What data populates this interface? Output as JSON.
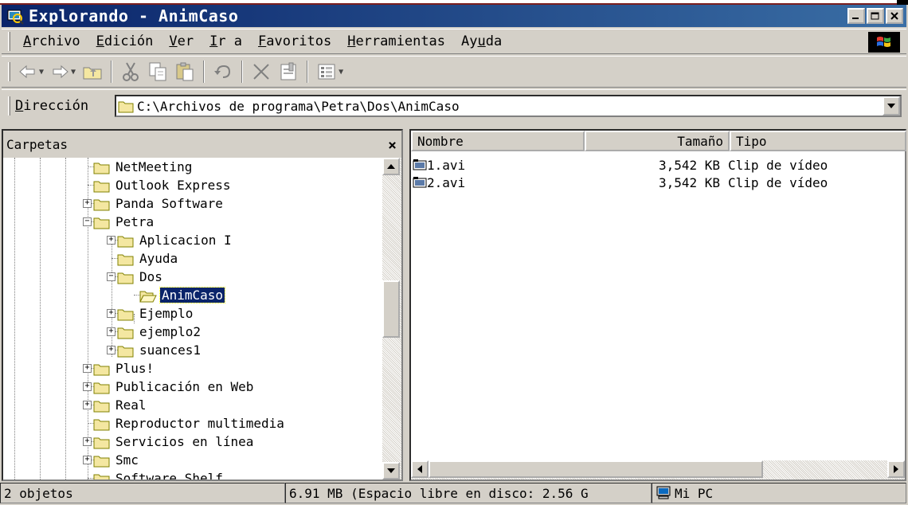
{
  "window": {
    "title": "Explorando - AnimCaso"
  },
  "menu": {
    "items": [
      {
        "u": "A",
        "rest": "rchivo"
      },
      {
        "u": "E",
        "rest": "dición"
      },
      {
        "u": "V",
        "rest": "er"
      },
      {
        "u": "I",
        "rest": "r a"
      },
      {
        "u": "F",
        "rest": "avoritos"
      },
      {
        "u": "H",
        "rest": "erramientas"
      },
      {
        "pre": "Ay",
        "u": "u",
        "rest": "da"
      }
    ]
  },
  "toolbar": {
    "buttons": [
      "back-icon",
      "forward-icon",
      "up-folder-icon",
      "cut-icon",
      "copy-icon",
      "paste-icon",
      "undo-icon",
      "delete-icon",
      "properties-icon",
      "views-icon"
    ]
  },
  "address": {
    "label_u": "D",
    "label_rest": "irección",
    "path": "C:\\Archivos de programa\\Petra\\Dos\\AnimCaso"
  },
  "folders": {
    "header": "Carpetas",
    "close": "×",
    "tree": [
      {
        "label": "NetMeeting",
        "expander": "none",
        "level": 0
      },
      {
        "label": "Outlook Express",
        "expander": "none",
        "level": 0
      },
      {
        "label": "Panda Software",
        "expander": "+",
        "level": 0
      },
      {
        "label": "Petra",
        "expander": "-",
        "level": 0
      },
      {
        "label": "Aplicacion I",
        "expander": "+",
        "level": 1
      },
      {
        "label": "Ayuda",
        "expander": "none",
        "level": 1
      },
      {
        "label": "Dos",
        "expander": "-",
        "level": 1
      },
      {
        "label": "AnimCaso",
        "expander": "none",
        "level": 2,
        "selected": true
      },
      {
        "label": "Ejemplo",
        "expander": "+",
        "level": 1
      },
      {
        "label": "ejemplo2",
        "expander": "+",
        "level": 1
      },
      {
        "label": "suances1",
        "expander": "+",
        "level": 1
      },
      {
        "label": "Plus!",
        "expander": "+",
        "level": 0
      },
      {
        "label": "Publicación en Web",
        "expander": "+",
        "level": 0
      },
      {
        "label": "Real",
        "expander": "+",
        "level": 0
      },
      {
        "label": "Reproductor multimedia",
        "expander": "none",
        "level": 0
      },
      {
        "label": "Servicios en línea",
        "expander": "+",
        "level": 0
      },
      {
        "label": "Smc",
        "expander": "+",
        "level": 0
      },
      {
        "label": "Software Shelf",
        "expander": "none",
        "level": 0
      }
    ]
  },
  "list": {
    "columns": [
      "Nombre",
      "Tamaño",
      "Tipo"
    ],
    "rows": [
      {
        "name": "1.avi",
        "size": "3,542 KB",
        "type": "Clip de vídeo"
      },
      {
        "name": "2.avi",
        "size": "3,542 KB",
        "type": "Clip de vídeo"
      }
    ]
  },
  "status": {
    "count": "2 objetos",
    "size": "6.91 MB (Espacio libre en disco: 2.56 G",
    "location": "Mi PC"
  }
}
